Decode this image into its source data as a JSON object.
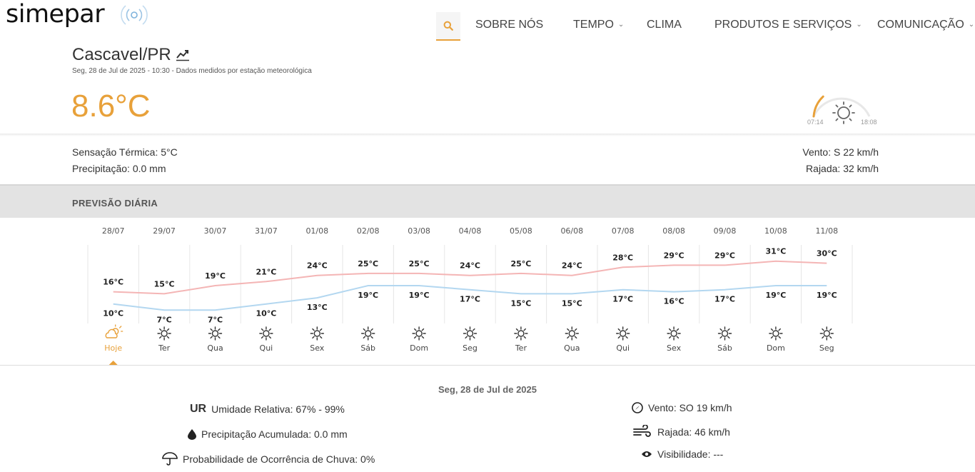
{
  "brand": {
    "name": "simepar"
  },
  "nav": {
    "items": [
      {
        "label": "SOBRE NÓS",
        "dropdown": false
      },
      {
        "label": "TEMPO",
        "dropdown": true
      },
      {
        "label": "CLIMA",
        "dropdown": false
      },
      {
        "label": "PRODUTOS E SERVIÇOS",
        "dropdown": true
      },
      {
        "label": "COMUNICAÇÃO",
        "dropdown": true
      }
    ],
    "chevron": "⌄"
  },
  "current": {
    "city": "Cascavel/PR",
    "subline": "Seg, 28 de Jul de 2025 - 10:30 - Dados medidos por estação meteorológica",
    "temperature": "8.6°C",
    "sunrise": "07:14",
    "sunset": "18:08",
    "sun_progress": 0.3,
    "feels_like": "Sensação Térmica: 5°C",
    "precipitation": "Precipitação: 0.0 mm",
    "wind": "Vento: S 22 km/h",
    "gust": "Rajada: 32 km/h"
  },
  "forecast": {
    "title": "PREVISÃO DIÁRIA",
    "days": [
      {
        "date": "28/07",
        "day": "Hoje",
        "max": 16,
        "min": 10,
        "icon": "partly-cloudy-icon"
      },
      {
        "date": "29/07",
        "day": "Ter",
        "max": 15,
        "min": 7,
        "icon": "sun-icon"
      },
      {
        "date": "30/07",
        "day": "Qua",
        "max": 19,
        "min": 7,
        "icon": "sun-icon"
      },
      {
        "date": "31/07",
        "day": "Qui",
        "max": 21,
        "min": 10,
        "icon": "sun-icon"
      },
      {
        "date": "01/08",
        "day": "Sex",
        "max": 24,
        "min": 13,
        "icon": "sun-icon"
      },
      {
        "date": "02/08",
        "day": "Sáb",
        "max": 25,
        "min": 19,
        "icon": "sun-icon"
      },
      {
        "date": "03/08",
        "day": "Dom",
        "max": 25,
        "min": 19,
        "icon": "sun-icon"
      },
      {
        "date": "04/08",
        "day": "Seg",
        "max": 24,
        "min": 17,
        "icon": "sun-icon"
      },
      {
        "date": "05/08",
        "day": "Ter",
        "max": 25,
        "min": 15,
        "icon": "sun-icon"
      },
      {
        "date": "06/08",
        "day": "Qua",
        "max": 24,
        "min": 15,
        "icon": "sun-icon"
      },
      {
        "date": "07/08",
        "day": "Qui",
        "max": 28,
        "min": 17,
        "icon": "sun-icon"
      },
      {
        "date": "08/08",
        "day": "Sex",
        "max": 29,
        "min": 16,
        "icon": "sun-icon"
      },
      {
        "date": "09/08",
        "day": "Sáb",
        "max": 29,
        "min": 17,
        "icon": "sun-icon"
      },
      {
        "date": "10/08",
        "day": "Dom",
        "max": 31,
        "min": 19,
        "icon": "sun-icon"
      },
      {
        "date": "11/08",
        "day": "Seg",
        "max": 30,
        "min": 19,
        "icon": "sun-icon"
      }
    ],
    "unit": "°C",
    "selected_index": 0,
    "colors": {
      "max": "#f4b5b5",
      "min": "#b3d7f0",
      "accent": "#e8a13a"
    }
  },
  "detail": {
    "date": "Seg, 28 de Jul de 2025",
    "ur_tag": "UR",
    "humidity": "Umidade Relativa: 67% - 99%",
    "precip_accum": "Precipitação Acumulada: 0.0 mm",
    "rain_prob": "Probabilidade de Ocorrência de Chuva: 0%",
    "wind": "Vento: SO 19 km/h",
    "gust": "Rajada: 46 km/h",
    "visibility": "Visibilidade: ---"
  }
}
